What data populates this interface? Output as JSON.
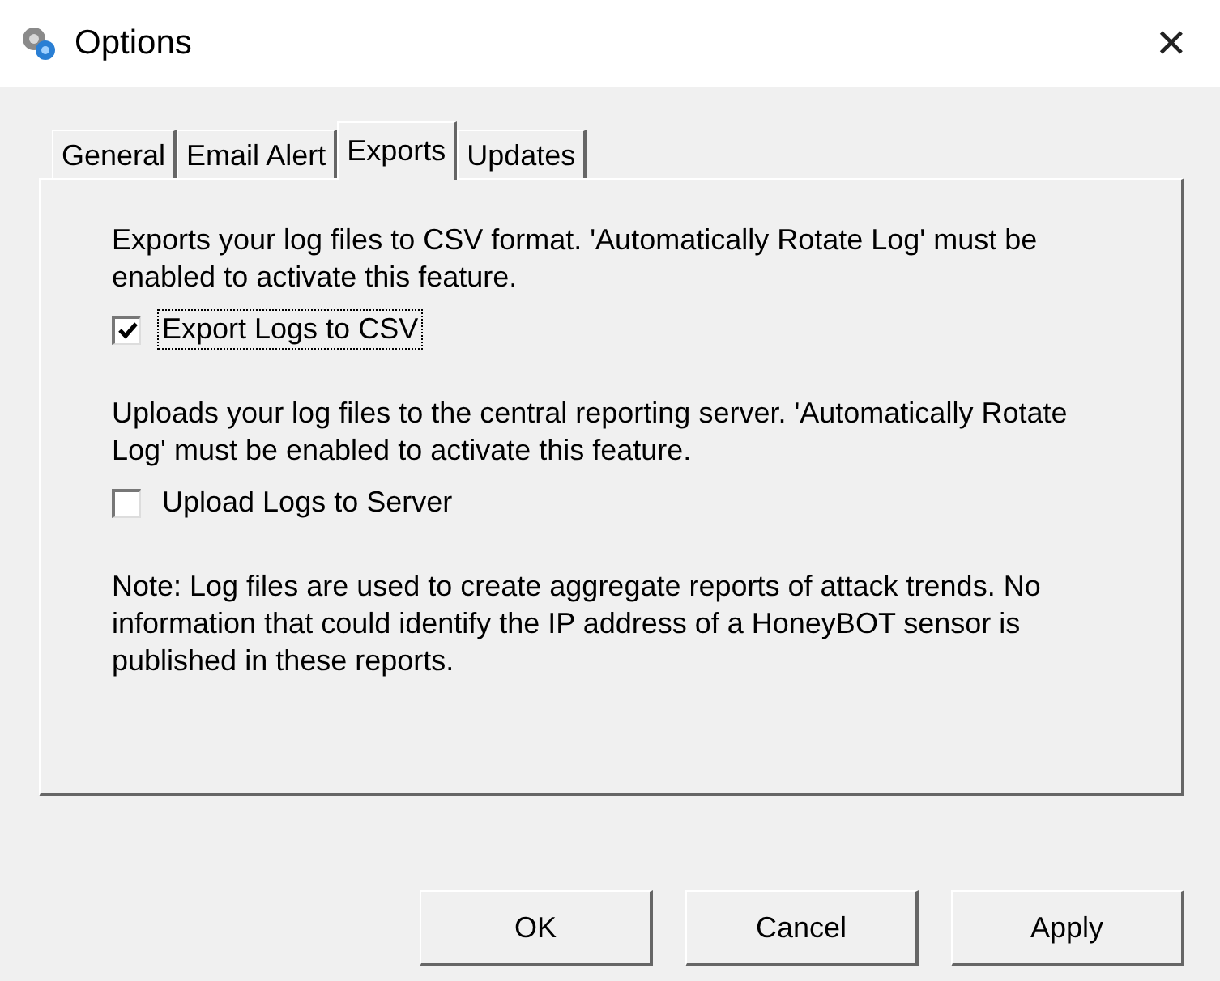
{
  "window": {
    "title": "Options",
    "close": "✕"
  },
  "tabs": [
    {
      "label": "General",
      "selected": false
    },
    {
      "label": "Email Alert",
      "selected": false
    },
    {
      "label": "Exports",
      "selected": true
    },
    {
      "label": "Updates",
      "selected": false
    }
  ],
  "sections": [
    {
      "description": "Exports your log files to CSV format. 'Automatically Rotate Log' must be enabled to activate this feature.",
      "option": {
        "label": "Export Logs to CSV",
        "checked": true,
        "focused": true
      }
    },
    {
      "description": "Uploads your log files to the central reporting server. 'Automatically Rotate Log' must be enabled to activate this feature.",
      "option": {
        "label": "Upload Logs to Server",
        "checked": false,
        "focused": false
      }
    }
  ],
  "note": "Note: Log files are used to create aggregate reports of attack trends. No information that could identify the IP address of a HoneyBOT sensor is published in these reports.",
  "buttons": [
    "OK",
    "Cancel",
    "Apply"
  ]
}
